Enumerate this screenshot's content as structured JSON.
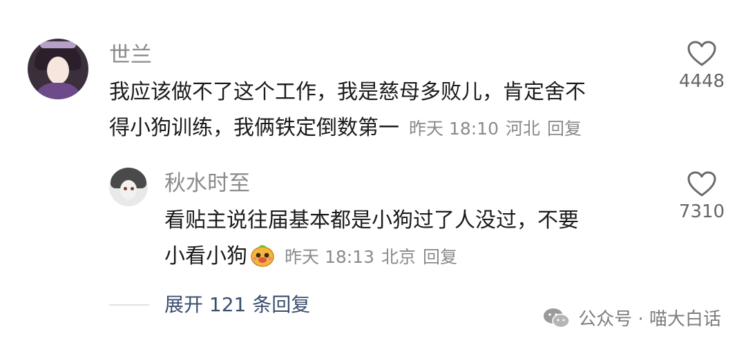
{
  "comment": {
    "username": "世兰",
    "line1": "我应该做不了这个工作，我是慈母多败儿，肯定舍不",
    "line2": "得小狗训练，我俩铁定倒数第一",
    "time": "昨天 18:10",
    "location": "河北",
    "reply_label": "回复",
    "likes": "4448"
  },
  "reply": {
    "username": "秋水时至",
    "line1": "看贴主说往届基本都是小狗过了人没过，不要",
    "line2": "小看小狗",
    "time": "昨天 18:13",
    "location": "北京",
    "reply_label": "回复",
    "likes": "7310"
  },
  "expand_label": "展开 121 条回复",
  "watermark": "公众号 · 喵大白话",
  "icons": {
    "like": "heart-outline-icon",
    "emoji": "dog-face-emoji",
    "watermark": "wechat-icon"
  }
}
